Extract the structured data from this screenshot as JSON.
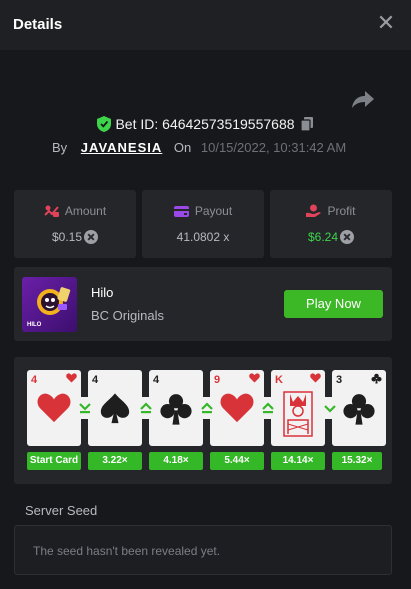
{
  "header": {
    "title": "Details"
  },
  "bet": {
    "id_text": "Bet ID: 64642573519557688",
    "by_label": "By",
    "username": "JAVANESIA",
    "on_label": "On",
    "date": "10/15/2022, 10:31:42 AM"
  },
  "stats": {
    "amount_label": "Amount",
    "amount_value": "$0.15",
    "payout_label": "Payout",
    "payout_value": "41.0802 x",
    "profit_label": "Profit",
    "profit_value": "$6.24",
    "profit_color": "#3ed44a"
  },
  "game": {
    "thumb_label": "HILO",
    "name": "Hilo",
    "provider": "BC Originals",
    "play_label": "Play Now"
  },
  "history": {
    "cards": [
      {
        "rank": "4",
        "suit": "heart",
        "color": "red"
      },
      {
        "rank": "4",
        "suit": "spade",
        "color": "black"
      },
      {
        "rank": "4",
        "suit": "club",
        "color": "black"
      },
      {
        "rank": "9",
        "suit": "heart",
        "color": "red"
      },
      {
        "rank": "K",
        "suit": "heart",
        "color": "red"
      },
      {
        "rank": "3",
        "suit": "club",
        "color": "black"
      }
    ],
    "arrows": [
      "down",
      "up",
      "up",
      "up",
      "down"
    ],
    "multipliers": [
      "Start Card",
      "3.22×",
      "4.18×",
      "5.44×",
      "14.14×",
      "15.32×"
    ]
  },
  "seed": {
    "label": "Server Seed",
    "text": "The seed hasn't been revealed yet."
  }
}
